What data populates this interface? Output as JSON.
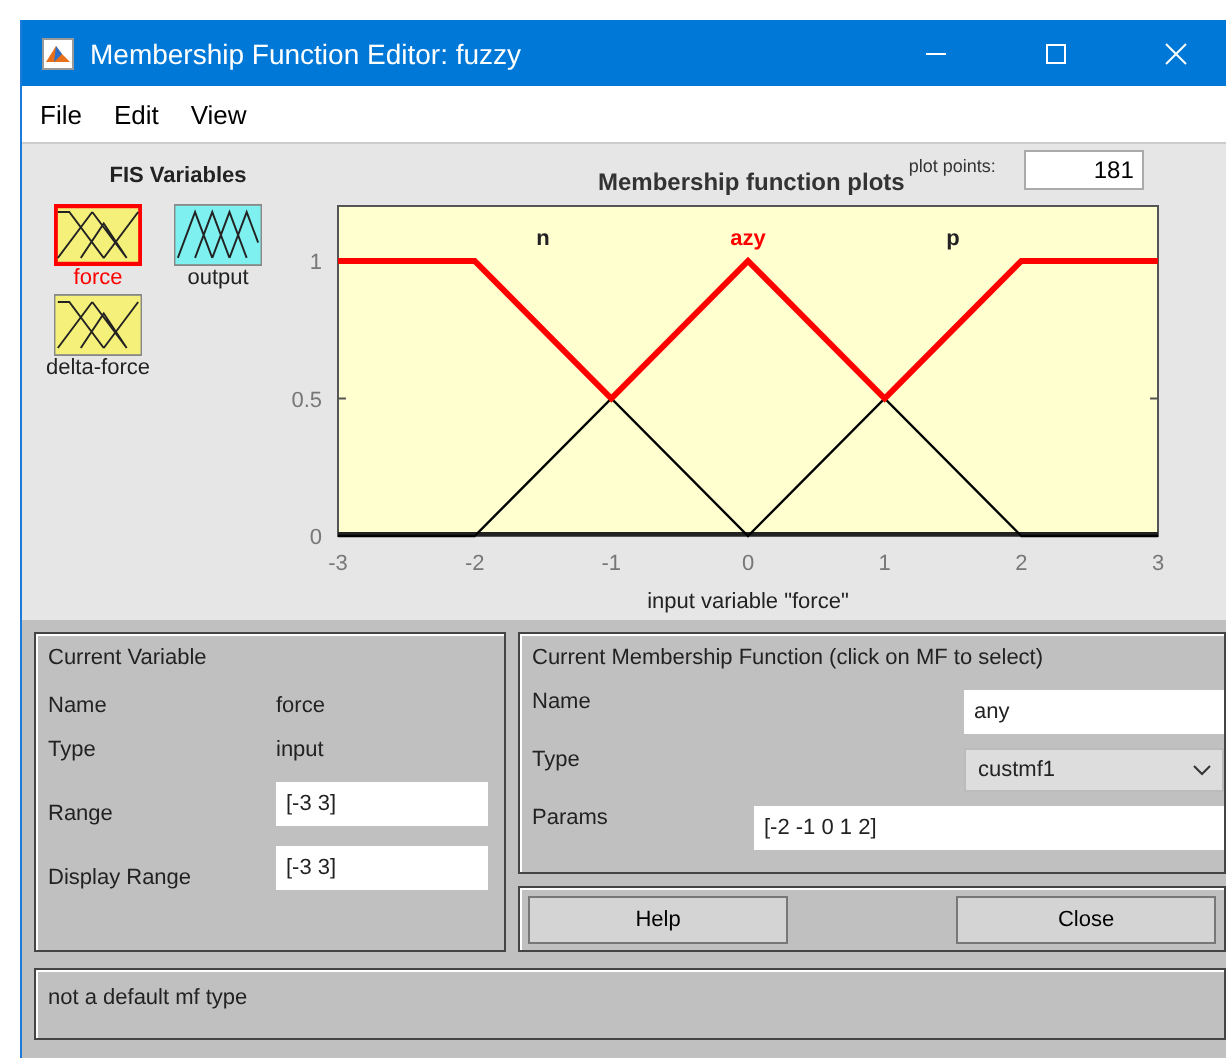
{
  "window": {
    "title": "Membership Function Editor: fuzzy"
  },
  "menu": [
    "File",
    "Edit",
    "View"
  ],
  "fis_variables": {
    "title": "FIS Variables",
    "items": [
      {
        "label": "force",
        "kind": "input",
        "selected": true
      },
      {
        "label": "output",
        "kind": "output",
        "selected": false
      },
      {
        "label": "delta-force",
        "kind": "input",
        "selected": false
      }
    ]
  },
  "plot": {
    "title": "Membership function plots",
    "plot_points_label": "plot points:",
    "plot_points": "181",
    "mf_labels": [
      {
        "text": "n",
        "selected": false
      },
      {
        "text": "azy",
        "selected": true
      },
      {
        "text": "p",
        "selected": false
      }
    ],
    "chart_data": {
      "type": "line",
      "xlabel": "input variable \"force\"",
      "x": [
        -3,
        -2,
        -1,
        0,
        1,
        2,
        3
      ],
      "xlim": [
        -3,
        3
      ],
      "ylim": [
        0,
        1.2
      ],
      "xticks": [
        -3,
        -2,
        -1,
        0,
        1,
        2,
        3
      ],
      "yticks": [
        0,
        0.5,
        1
      ],
      "series": [
        {
          "color": "#ff0000",
          "values": [
            1,
            1,
            0.5,
            1,
            0.5,
            1,
            1
          ]
        },
        {
          "color": "#000000",
          "values": [
            0,
            0,
            0.5,
            0,
            0.5,
            0,
            0
          ]
        }
      ]
    }
  },
  "current_variable": {
    "title": "Current Variable",
    "name_label": "Name",
    "name": "force",
    "type_label": "Type",
    "type": "input",
    "range_label": "Range",
    "range": "[-3 3]",
    "display_range_label": "Display Range",
    "display_range": "[-3 3]"
  },
  "current_mf": {
    "title": "Current Membership Function (click on MF to select)",
    "name_label": "Name",
    "name": "any",
    "type_label": "Type",
    "type": "custmf1",
    "params_label": "Params",
    "params": "[-2 -1 0 1 2]"
  },
  "buttons": [
    "Help",
    "Close"
  ],
  "status": "not a default mf type"
}
